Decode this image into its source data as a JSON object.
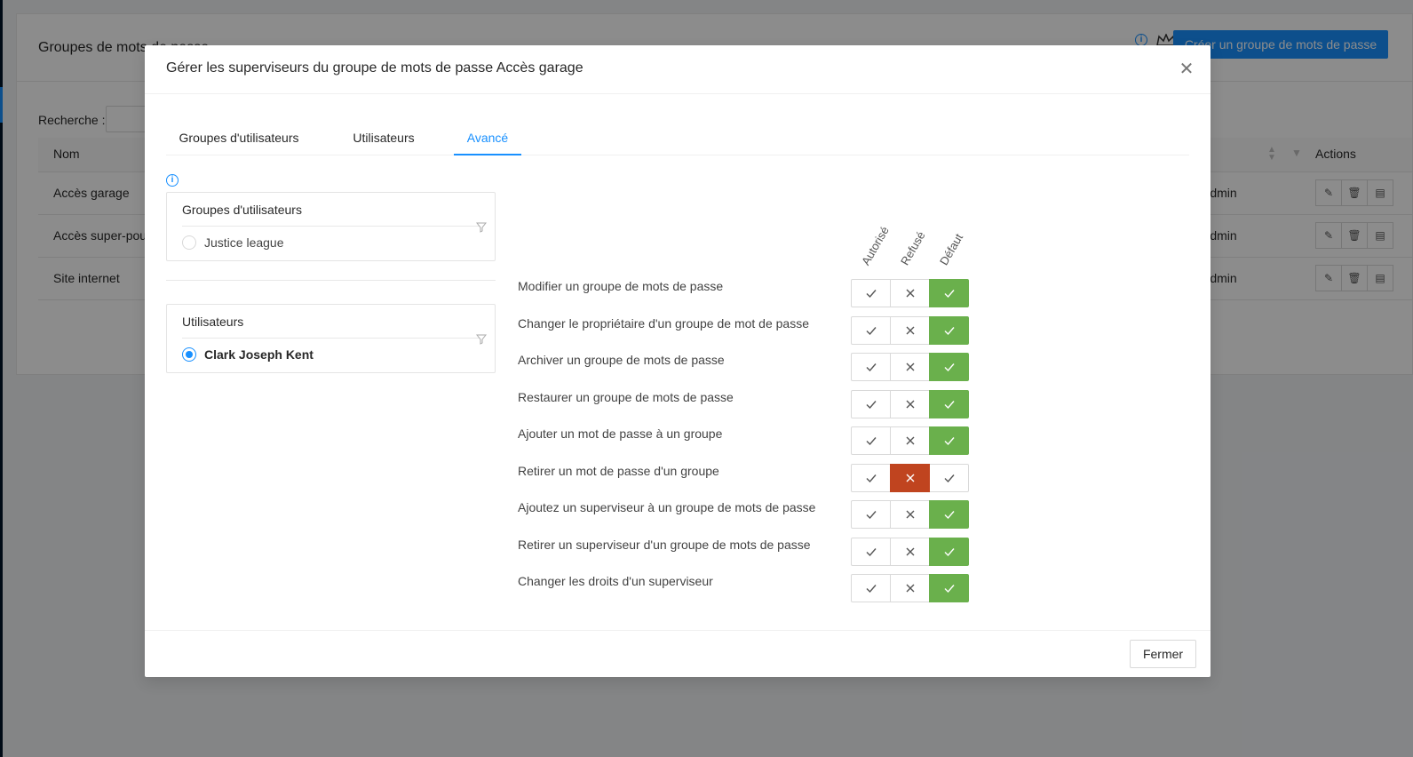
{
  "background": {
    "card_title": "Groupes de mots de passe",
    "create_button": "Créer un groupe de mots de passe",
    "search_label": "Recherche :",
    "table": {
      "columns": {
        "name": "Nom",
        "actions": "Actions"
      },
      "rows": [
        {
          "name": "Accès garage",
          "owner": "Admin"
        },
        {
          "name": "Accès super-pouvoirs",
          "owner": "Admin"
        },
        {
          "name": "Site internet",
          "owner": "Admin"
        }
      ]
    }
  },
  "modal": {
    "title": "Gérer les superviseurs du groupe de mots de passe Accès garage",
    "tabs": [
      {
        "label": "Groupes d'utilisateurs",
        "active": false
      },
      {
        "label": "Utilisateurs",
        "active": false
      },
      {
        "label": "Avancé",
        "active": true
      }
    ],
    "groups_panel": {
      "title": "Groupes d'utilisateurs",
      "items": [
        {
          "label": "Justice league",
          "checked": false
        }
      ]
    },
    "users_panel": {
      "title": "Utilisateurs",
      "items": [
        {
          "label": "Clark Joseph Kent",
          "checked": true
        }
      ]
    },
    "columns": [
      "Autorisé",
      "Refusé",
      "Défaut"
    ],
    "permissions": [
      {
        "label": "Modifier un groupe de mots de passe",
        "state": "default"
      },
      {
        "label": "Changer le propriétaire d'un groupe de mot de passe",
        "state": "default"
      },
      {
        "label": "Archiver un groupe de mots de passe",
        "state": "default"
      },
      {
        "label": "Restaurer un groupe de mots de passe",
        "state": "default"
      },
      {
        "label": "Ajouter un mot de passe à un groupe",
        "state": "default"
      },
      {
        "label": "Retirer un mot de passe d'un groupe",
        "state": "denied"
      },
      {
        "label": "Ajoutez un superviseur à un groupe de mots de passe",
        "state": "default"
      },
      {
        "label": "Retirer un superviseur d'un groupe de mots de passe",
        "state": "default"
      },
      {
        "label": "Changer les droits d'un superviseur",
        "state": "default"
      }
    ],
    "close_button": "Fermer"
  },
  "colors": {
    "primary": "#1890ff",
    "default_green": "#6ab04c",
    "denied_red": "#c0441f"
  }
}
